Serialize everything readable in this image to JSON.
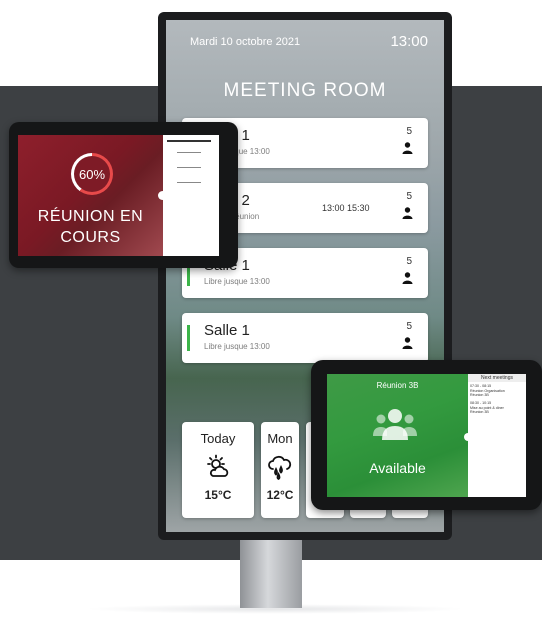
{
  "kiosk": {
    "date": "Mardi 10 octobre 2021",
    "time": "13:00",
    "title": "MEETING ROOM",
    "rooms": [
      {
        "name": "Salle 1",
        "sub": "Libre jusque 13:00",
        "times": "",
        "capacity": "5"
      },
      {
        "name": "Salle 2",
        "sub": "Libre la réunion",
        "times": "13:00 15:30",
        "capacity": "5"
      },
      {
        "name": "Salle 1",
        "sub": "Libre jusque 13:00",
        "times": "",
        "capacity": "5"
      },
      {
        "name": "Salle 1",
        "sub": "Libre jusque 13:00",
        "times": "",
        "capacity": "5"
      }
    ],
    "weather": [
      {
        "day": "Today",
        "temp": "15°C",
        "icon": "sun-cloud-icon"
      },
      {
        "day": "Mon",
        "temp": "12°C",
        "icon": "rain-cloud-icon"
      }
    ]
  },
  "tablet_left": {
    "progress_label": "60%",
    "progress": 0.6,
    "status": "RÉUNION EN COURS"
  },
  "tablet_right": {
    "room": "Réunion 3B",
    "status": "Available",
    "side_title": "Next meetings",
    "meetings": [
      {
        "time": "07:30 - 08:15",
        "title": "Réunion Organisation",
        "sub": "Réunion 3B"
      },
      {
        "time": "08:30 - 10:15",
        "title": "Mise au point & diner",
        "sub": "Réunion 3B"
      }
    ]
  },
  "colors": {
    "available": "#3cb54a",
    "busy": "#8e1f2c",
    "progress_ring": "#e84a4a"
  }
}
